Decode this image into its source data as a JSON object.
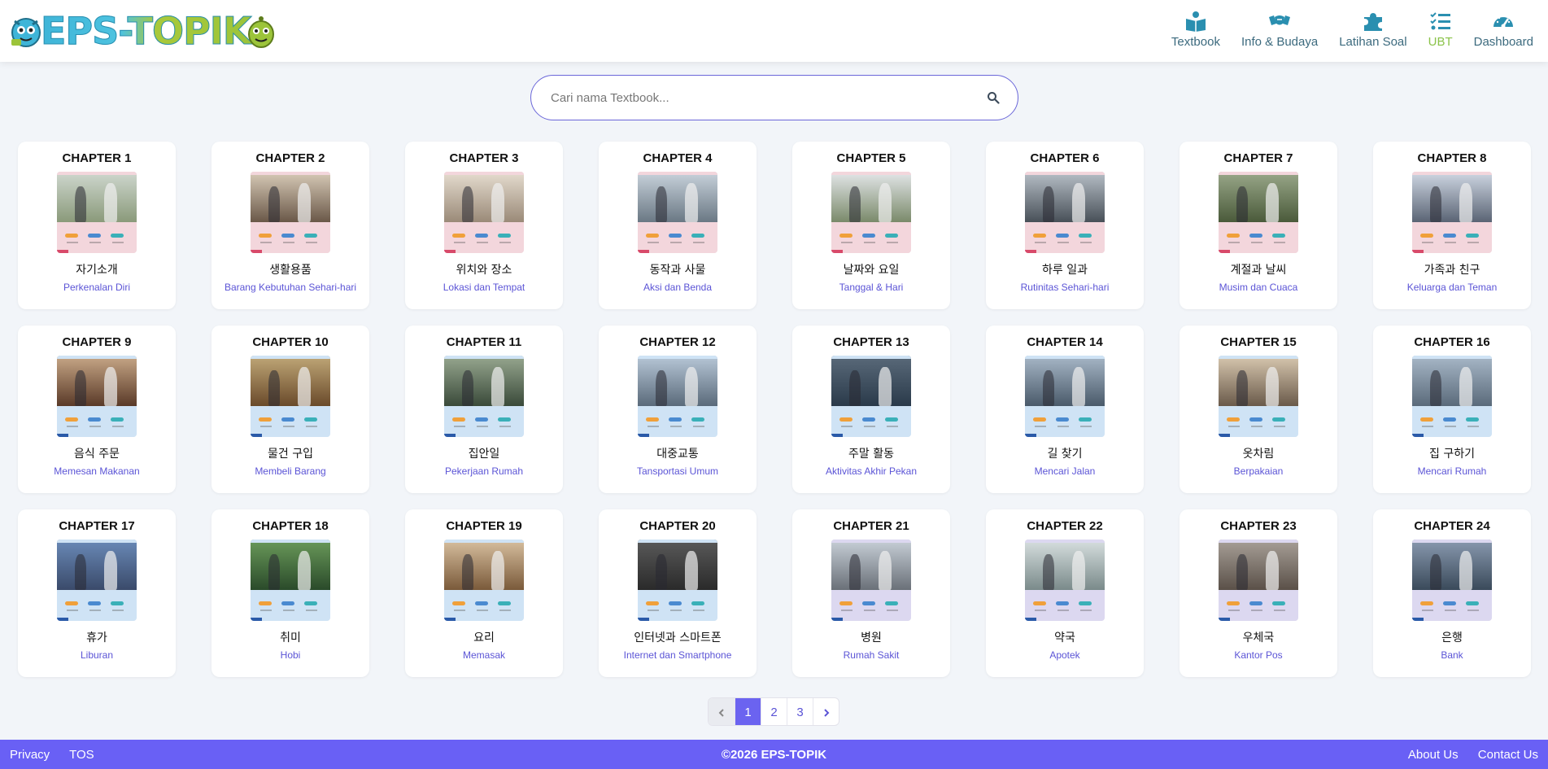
{
  "brand": {
    "logo_text": "EPS-TOPIK"
  },
  "nav": [
    {
      "label": "Textbook",
      "icon": "book-icon",
      "active": false
    },
    {
      "label": "Info & Budaya",
      "icon": "handshake-icon",
      "active": false
    },
    {
      "label": "Latihan Soal",
      "icon": "puzzle-icon",
      "active": false
    },
    {
      "label": "UBT",
      "icon": "list-check-icon",
      "active": true
    },
    {
      "label": "Dashboard",
      "icon": "gauge-icon",
      "active": false
    }
  ],
  "search": {
    "placeholder": "Cari nama Textbook...",
    "value": ""
  },
  "chapters": [
    {
      "title": "CHAPTER 1",
      "korean": "자기소개",
      "indonesian": "Perkenalan Diri"
    },
    {
      "title": "CHAPTER 2",
      "korean": "생활용품",
      "indonesian": "Barang Kebutuhan Sehari-hari"
    },
    {
      "title": "CHAPTER 3",
      "korean": "위치와 장소",
      "indonesian": "Lokasi dan Tempat"
    },
    {
      "title": "CHAPTER 4",
      "korean": "동작과 사물",
      "indonesian": "Aksi dan Benda"
    },
    {
      "title": "CHAPTER 5",
      "korean": "날짜와 요일",
      "indonesian": "Tanggal & Hari"
    },
    {
      "title": "CHAPTER 6",
      "korean": "하루 일과",
      "indonesian": "Rutinitas Sehari-hari"
    },
    {
      "title": "CHAPTER 7",
      "korean": "계절과 날씨",
      "indonesian": "Musim dan Cuaca"
    },
    {
      "title": "CHAPTER 8",
      "korean": "가족과 친구",
      "indonesian": "Keluarga dan Teman"
    },
    {
      "title": "CHAPTER 9",
      "korean": "음식 주문",
      "indonesian": "Memesan Makanan"
    },
    {
      "title": "CHAPTER 10",
      "korean": "물건 구입",
      "indonesian": "Membeli Barang"
    },
    {
      "title": "CHAPTER 11",
      "korean": "집안일",
      "indonesian": "Pekerjaan Rumah"
    },
    {
      "title": "CHAPTER 12",
      "korean": "대중교통",
      "indonesian": "Tansportasi Umum"
    },
    {
      "title": "CHAPTER 13",
      "korean": "주말 활동",
      "indonesian": "Aktivitas Akhir Pekan"
    },
    {
      "title": "CHAPTER 14",
      "korean": "길 찾기",
      "indonesian": "Mencari Jalan"
    },
    {
      "title": "CHAPTER 15",
      "korean": "옷차림",
      "indonesian": "Berpakaian"
    },
    {
      "title": "CHAPTER 16",
      "korean": "집 구하기",
      "indonesian": "Mencari Rumah"
    },
    {
      "title": "CHAPTER 17",
      "korean": "휴가",
      "indonesian": "Liburan"
    },
    {
      "title": "CHAPTER 18",
      "korean": "취미",
      "indonesian": "Hobi"
    },
    {
      "title": "CHAPTER 19",
      "korean": "요리",
      "indonesian": "Memasak"
    },
    {
      "title": "CHAPTER 20",
      "korean": "인터넷과 스마트폰",
      "indonesian": "Internet dan Smartphone"
    },
    {
      "title": "CHAPTER 21",
      "korean": "병원",
      "indonesian": "Rumah Sakit"
    },
    {
      "title": "CHAPTER 22",
      "korean": "약국",
      "indonesian": "Apotek"
    },
    {
      "title": "CHAPTER 23",
      "korean": "우체국",
      "indonesian": "Kantor Pos"
    },
    {
      "title": "CHAPTER 24",
      "korean": "은행",
      "indonesian": "Bank"
    }
  ],
  "pagination": {
    "pages": [
      "1",
      "2",
      "3"
    ],
    "current": "1"
  },
  "footer": {
    "links_left": [
      "Privacy",
      "TOS"
    ],
    "copyright": "©2026 EPS-TOPIK",
    "links_right": [
      "About Us",
      "Contact Us"
    ]
  },
  "colors": {
    "accent": "#6960f5",
    "nav_icon": "#2a8fb0",
    "nav_active": "#8bc34a",
    "link_text": "#5b54d6",
    "thumb_pink": "#f3d6dc",
    "thumb_blue": "#cfe3f5",
    "thumb_lilac": "#dcd8f0"
  }
}
